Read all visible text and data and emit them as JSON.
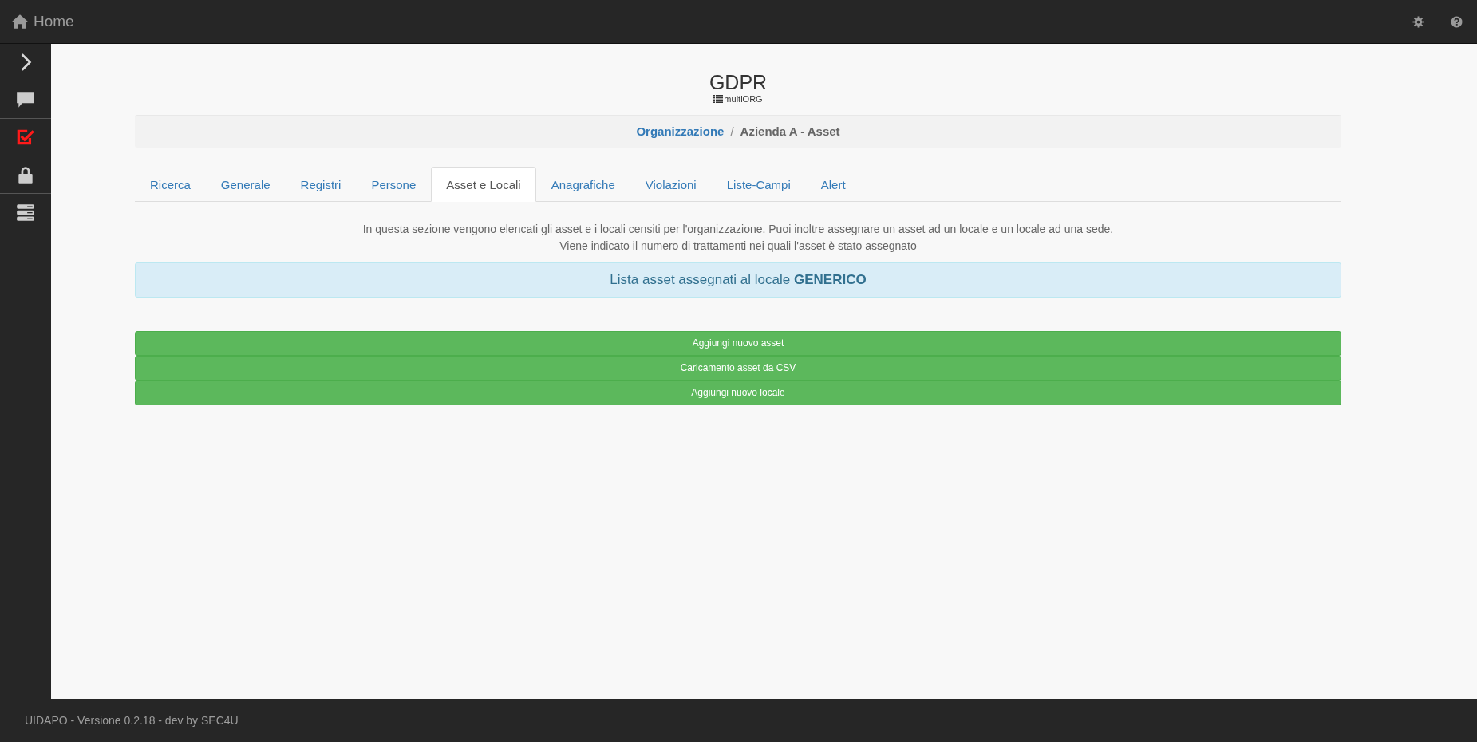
{
  "header": {
    "title": "Home"
  },
  "sidebar": {
    "items": [
      {
        "kind": "expand",
        "selected": false
      },
      {
        "kind": "chat",
        "selected": false
      },
      {
        "kind": "checklist",
        "selected": true
      },
      {
        "kind": "lock",
        "selected": false
      },
      {
        "kind": "server",
        "selected": false
      }
    ]
  },
  "page": {
    "title": "GDPR",
    "subtitle": "multiORG"
  },
  "breadcrumb": [
    {
      "label": "Organizzazione",
      "kind": "link"
    },
    {
      "label": "/",
      "kind": "separator"
    },
    {
      "label": "Azienda A - Asset",
      "kind": "current"
    }
  ],
  "tabs": [
    {
      "label": "Ricerca",
      "selected": false
    },
    {
      "label": "Generale",
      "selected": false
    },
    {
      "label": "Registri",
      "selected": false
    },
    {
      "label": "Persone",
      "selected": false
    },
    {
      "label": "Asset e Locali",
      "selected": true
    },
    {
      "label": "Anagrafiche",
      "selected": false
    },
    {
      "label": "Violazioni",
      "selected": false
    },
    {
      "label": "Liste-Campi",
      "selected": false
    },
    {
      "label": "Alert",
      "selected": false
    }
  ],
  "description": [
    "In questa sezione vengono elencati gli asset e i locali censiti per l'organizzazione. Puoi inoltre assegnare un asset ad un locale e un locale ad una sede.",
    "Viene indicato il numero di trattamenti nei quali l'asset è stato assegnato"
  ],
  "info_panel": {
    "text": "Lista asset assegnati al locale **GENERICO**"
  },
  "buttons": [
    "Aggiungi nuovo asset",
    "Caricamento asset da CSV",
    "Aggiungi nuovo locale"
  ],
  "footer": {
    "text": "UIDAPO - Versione 0.2.18 - dev by SEC4U"
  }
}
